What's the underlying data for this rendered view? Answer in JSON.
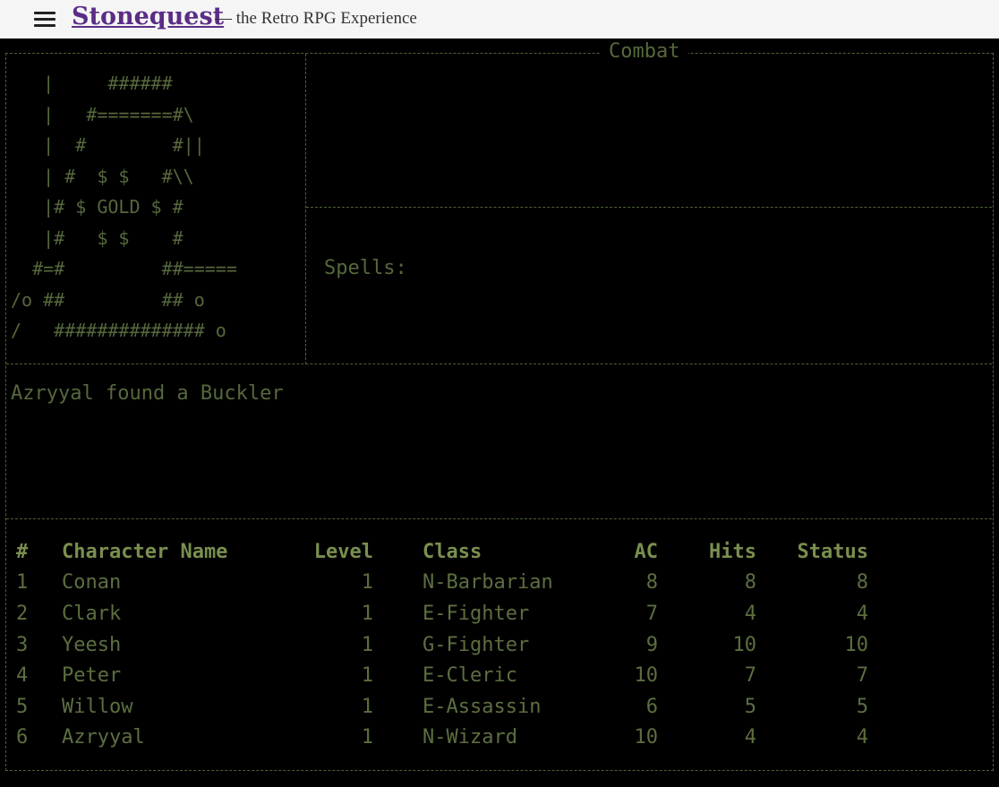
{
  "header": {
    "brand": "Stonequest",
    "tagline": "— the Retro RPG Experience"
  },
  "icons": {
    "menu": "hamburger-menu-icon"
  },
  "colors": {
    "brand": "#5b2d86",
    "terminal_text": "#6b7d4a",
    "background": "#000000"
  },
  "combat": {
    "title": "Combat",
    "ascii_art": "   |     ######\n   |   #=======#\\\n   |  #        #||\n   | #  $ $   #\\\\\n   |# $ GOLD $ #\n   |#   $ $    #\n  #=#         ##=====\n/o ##         ## o\n/   ############## o",
    "spells_label": "Spells:",
    "message": "Azryyal found a Buckler"
  },
  "party": {
    "headers": [
      "#",
      "Character Name",
      "Level",
      "Class",
      "AC",
      "Hits",
      "Status"
    ],
    "rows": [
      {
        "num": "1",
        "name": "Conan",
        "level": "1",
        "class": "N-Barbarian",
        "ac": "8",
        "hits": "8",
        "status": "8"
      },
      {
        "num": "2",
        "name": "Clark",
        "level": "1",
        "class": "E-Fighter",
        "ac": "7",
        "hits": "4",
        "status": "4"
      },
      {
        "num": "3",
        "name": "Yeesh",
        "level": "1",
        "class": "G-Fighter",
        "ac": "9",
        "hits": "10",
        "status": "10"
      },
      {
        "num": "4",
        "name": "Peter",
        "level": "1",
        "class": "E-Cleric",
        "ac": "10",
        "hits": "7",
        "status": "7"
      },
      {
        "num": "5",
        "name": "Willow",
        "level": "1",
        "class": "E-Assassin",
        "ac": "6",
        "hits": "5",
        "status": "5"
      },
      {
        "num": "6",
        "name": "Azryyal",
        "level": "1",
        "class": "N-Wizard",
        "ac": "10",
        "hits": "4",
        "status": "4"
      }
    ]
  }
}
